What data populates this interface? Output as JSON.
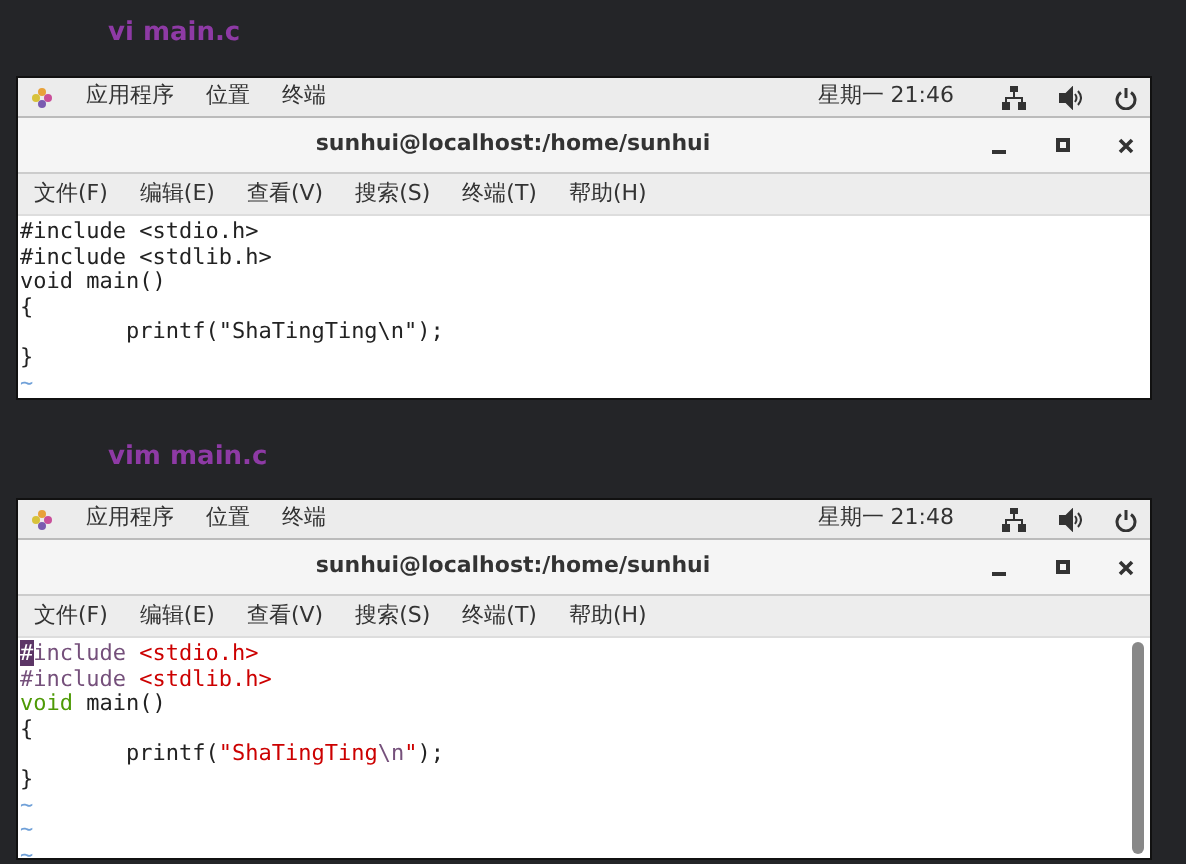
{
  "sections": [
    {
      "heading": "vi main.c",
      "screen": {
        "top_menus": [
          "应用程序",
          "位置",
          "终端"
        ],
        "clock": "星期一 21:46",
        "title": "sunhui@localhost:/home/sunhui",
        "menubar": [
          "文件(F)",
          "编辑(E)",
          "查看(V)",
          "搜索(S)",
          "终端(T)",
          "帮助(H)"
        ],
        "scrollbar": false,
        "lines": [
          [
            {
              "text": "#include <stdio.h>",
              "kind": "plain"
            }
          ],
          [
            {
              "text": "#include <stdlib.h>",
              "kind": "plain"
            }
          ],
          [
            {
              "text": "void main()",
              "kind": "plain"
            }
          ],
          [
            {
              "text": "{",
              "kind": "plain"
            }
          ],
          [
            {
              "text": "        printf(\"ShaTingTing\\n\");",
              "kind": "plain"
            }
          ],
          [
            {
              "text": "}",
              "kind": "plain"
            }
          ],
          [
            {
              "text": "~",
              "kind": "tilde"
            }
          ]
        ]
      }
    },
    {
      "heading": "vim main.c",
      "screen": {
        "top_menus": [
          "应用程序",
          "位置",
          "终端"
        ],
        "clock": "星期一 21:48",
        "title": "sunhui@localhost:/home/sunhui",
        "menubar": [
          "文件(F)",
          "编辑(E)",
          "查看(V)",
          "搜索(S)",
          "终端(T)",
          "帮助(H)"
        ],
        "scrollbar": true,
        "lines": [
          [
            {
              "text": "#",
              "kind": "cursor"
            },
            {
              "text": "include ",
              "kind": "preproc"
            },
            {
              "text": "<stdio.h>",
              "kind": "string"
            }
          ],
          [
            {
              "text": "#include ",
              "kind": "preproc"
            },
            {
              "text": "<stdlib.h>",
              "kind": "string"
            }
          ],
          [
            {
              "text": "void",
              "kind": "type"
            },
            {
              "text": " main()",
              "kind": "plain"
            }
          ],
          [
            {
              "text": "{",
              "kind": "plain"
            }
          ],
          [
            {
              "text": "        printf(",
              "kind": "plain"
            },
            {
              "text": "\"ShaTingTing",
              "kind": "string"
            },
            {
              "text": "\\n",
              "kind": "special"
            },
            {
              "text": "\"",
              "kind": "string"
            },
            {
              "text": ");",
              "kind": "plain"
            }
          ],
          [
            {
              "text": "}",
              "kind": "plain"
            }
          ],
          [
            {
              "text": "~",
              "kind": "tilde"
            }
          ],
          [
            {
              "text": "~",
              "kind": "tilde"
            }
          ],
          [
            {
              "text": "~",
              "kind": "tilde"
            }
          ]
        ]
      }
    }
  ]
}
